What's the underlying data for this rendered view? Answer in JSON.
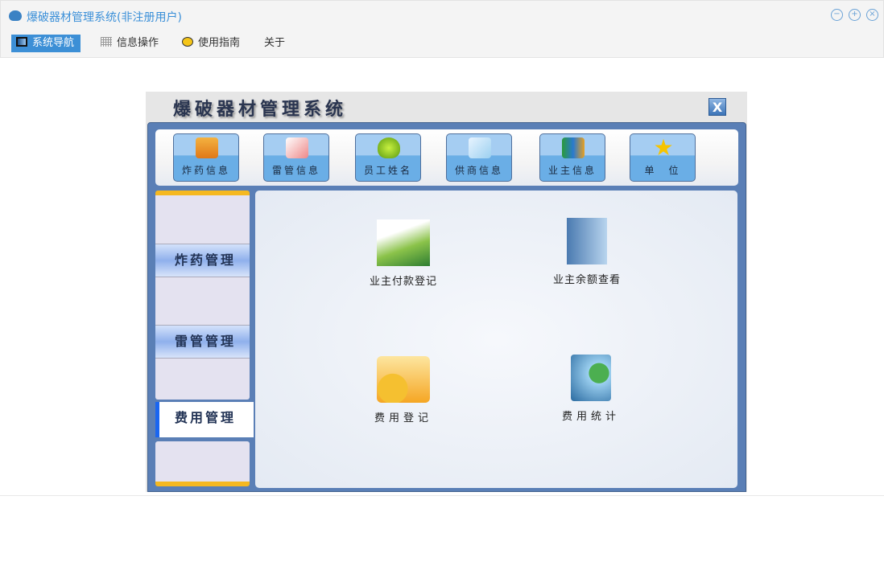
{
  "window": {
    "title": "爆破器材管理系统(非注册用户)",
    "controls": [
      "minimize",
      "maximize",
      "close"
    ]
  },
  "menu": [
    {
      "label": "系统导航",
      "icon": "monitor-icon"
    },
    {
      "label": "信息操作",
      "icon": "grid-icon"
    },
    {
      "label": "使用指南",
      "icon": "help-icon"
    },
    {
      "label": "关于"
    }
  ],
  "app": {
    "title": "爆破器材管理系统",
    "close": "X",
    "toolbar": [
      {
        "label": "炸药信息",
        "icon": "house-icon"
      },
      {
        "label": "雷管信息",
        "icon": "book-icon"
      },
      {
        "label": "员工姓名",
        "icon": "person-icon"
      },
      {
        "label": "供商信息",
        "icon": "chart-icon"
      },
      {
        "label": "业主信息",
        "icon": "bar-book-icon"
      },
      {
        "label": "单　位",
        "icon": "star-icon"
      }
    ],
    "sidebar": [
      {
        "label": "炸药管理"
      },
      {
        "label": "雷管管理"
      },
      {
        "label": "费用管理",
        "selected": true
      }
    ],
    "items": [
      {
        "label": "业主付款登记",
        "icon": "books-icon"
      },
      {
        "label": "业主余额查看",
        "icon": "magnifier-book-icon"
      },
      {
        "label": "费用登记",
        "icon": "coins-icon"
      },
      {
        "label": "费用统计",
        "icon": "globe-monitor-icon"
      }
    ]
  }
}
